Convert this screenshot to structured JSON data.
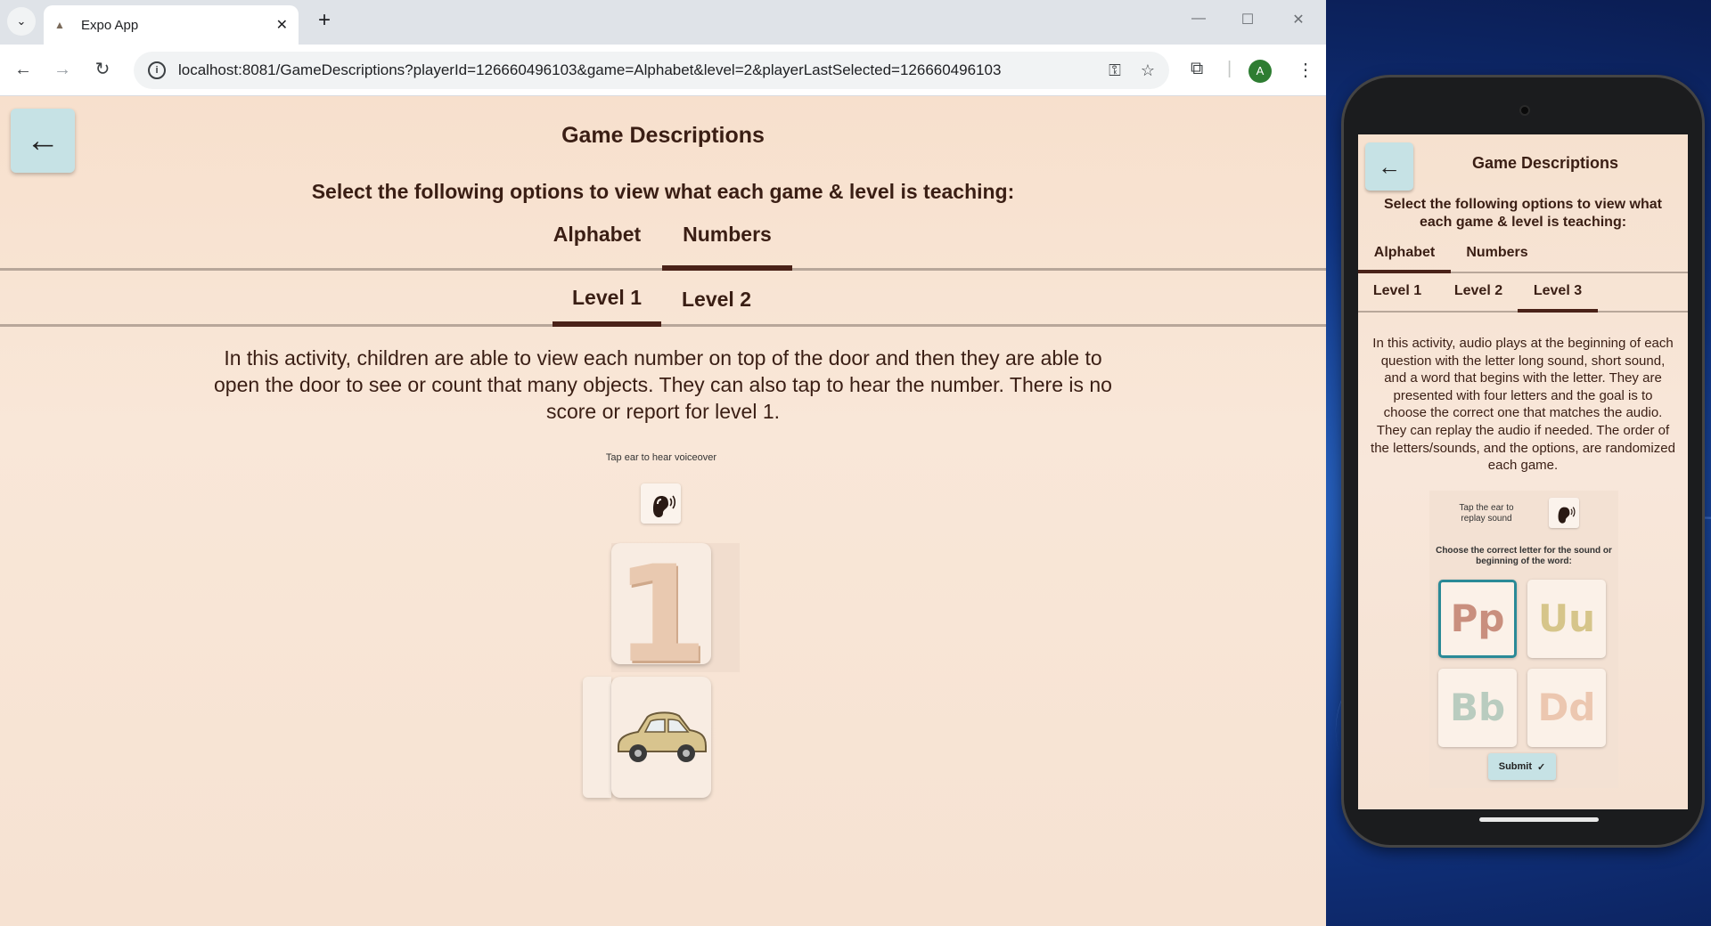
{
  "browser": {
    "tab_title": "Expo App",
    "url": "localhost:8081/GameDescriptions?playerId=126660496103&game=Alphabet&level=2&playerLastSelected=126660496103",
    "profile_initial": "A"
  },
  "page": {
    "title": "Game Descriptions",
    "subtitle": "Select the following options to view what each game & level is teaching:",
    "game_tabs": [
      {
        "label": "Alphabet",
        "active": false
      },
      {
        "label": "Numbers",
        "active": true
      }
    ],
    "level_tabs": [
      {
        "label": "Level 1",
        "active": true
      },
      {
        "label": "Level 2",
        "active": false
      }
    ],
    "description": "In this activity, children are able to view each number on top of the door and then they are able to open the door to see or count that many objects. They can also tap to hear the number.  There is no score or report for level 1.",
    "demo": {
      "caption": "Tap ear to hear voiceover",
      "number": "1"
    }
  },
  "phone": {
    "title": "Game Descriptions",
    "subtitle": "Select the following options to view what each game & level is teaching:",
    "game_tabs": [
      {
        "label": "Alphabet",
        "active": true
      },
      {
        "label": "Numbers",
        "active": false
      }
    ],
    "level_tabs": [
      {
        "label": "Level 1",
        "active": false
      },
      {
        "label": "Level 2",
        "active": false
      },
      {
        "label": "Level 3",
        "active": true
      }
    ],
    "description": "In this activity, audio plays at the beginning of each question with the letter long sound, short sound, and a word that begins with the letter. They are presented with four letters and the goal is to choose the correct one that matches the audio. They can replay the audio if needed. The order of the letters/sounds, and the options, are randomized each game.",
    "demo": {
      "replay_caption": "Tap the ear to replay sound",
      "instruction": "Choose the correct letter for the sound or beginning of the word:",
      "letters": [
        {
          "text": "Pp",
          "color": "#c98f7e",
          "selected": true
        },
        {
          "text": "Uu",
          "color": "#d6c58a",
          "selected": false
        },
        {
          "text": "Bb",
          "color": "#b9ccbf",
          "selected": false
        },
        {
          "text": "Dd",
          "color": "#ecc7b0",
          "selected": false
        }
      ],
      "submit_label": "Submit"
    }
  },
  "colors": {
    "accent_button": "#c6e2e5",
    "text_brown": "#3a1e14",
    "tab_underline": "#4a2218"
  }
}
